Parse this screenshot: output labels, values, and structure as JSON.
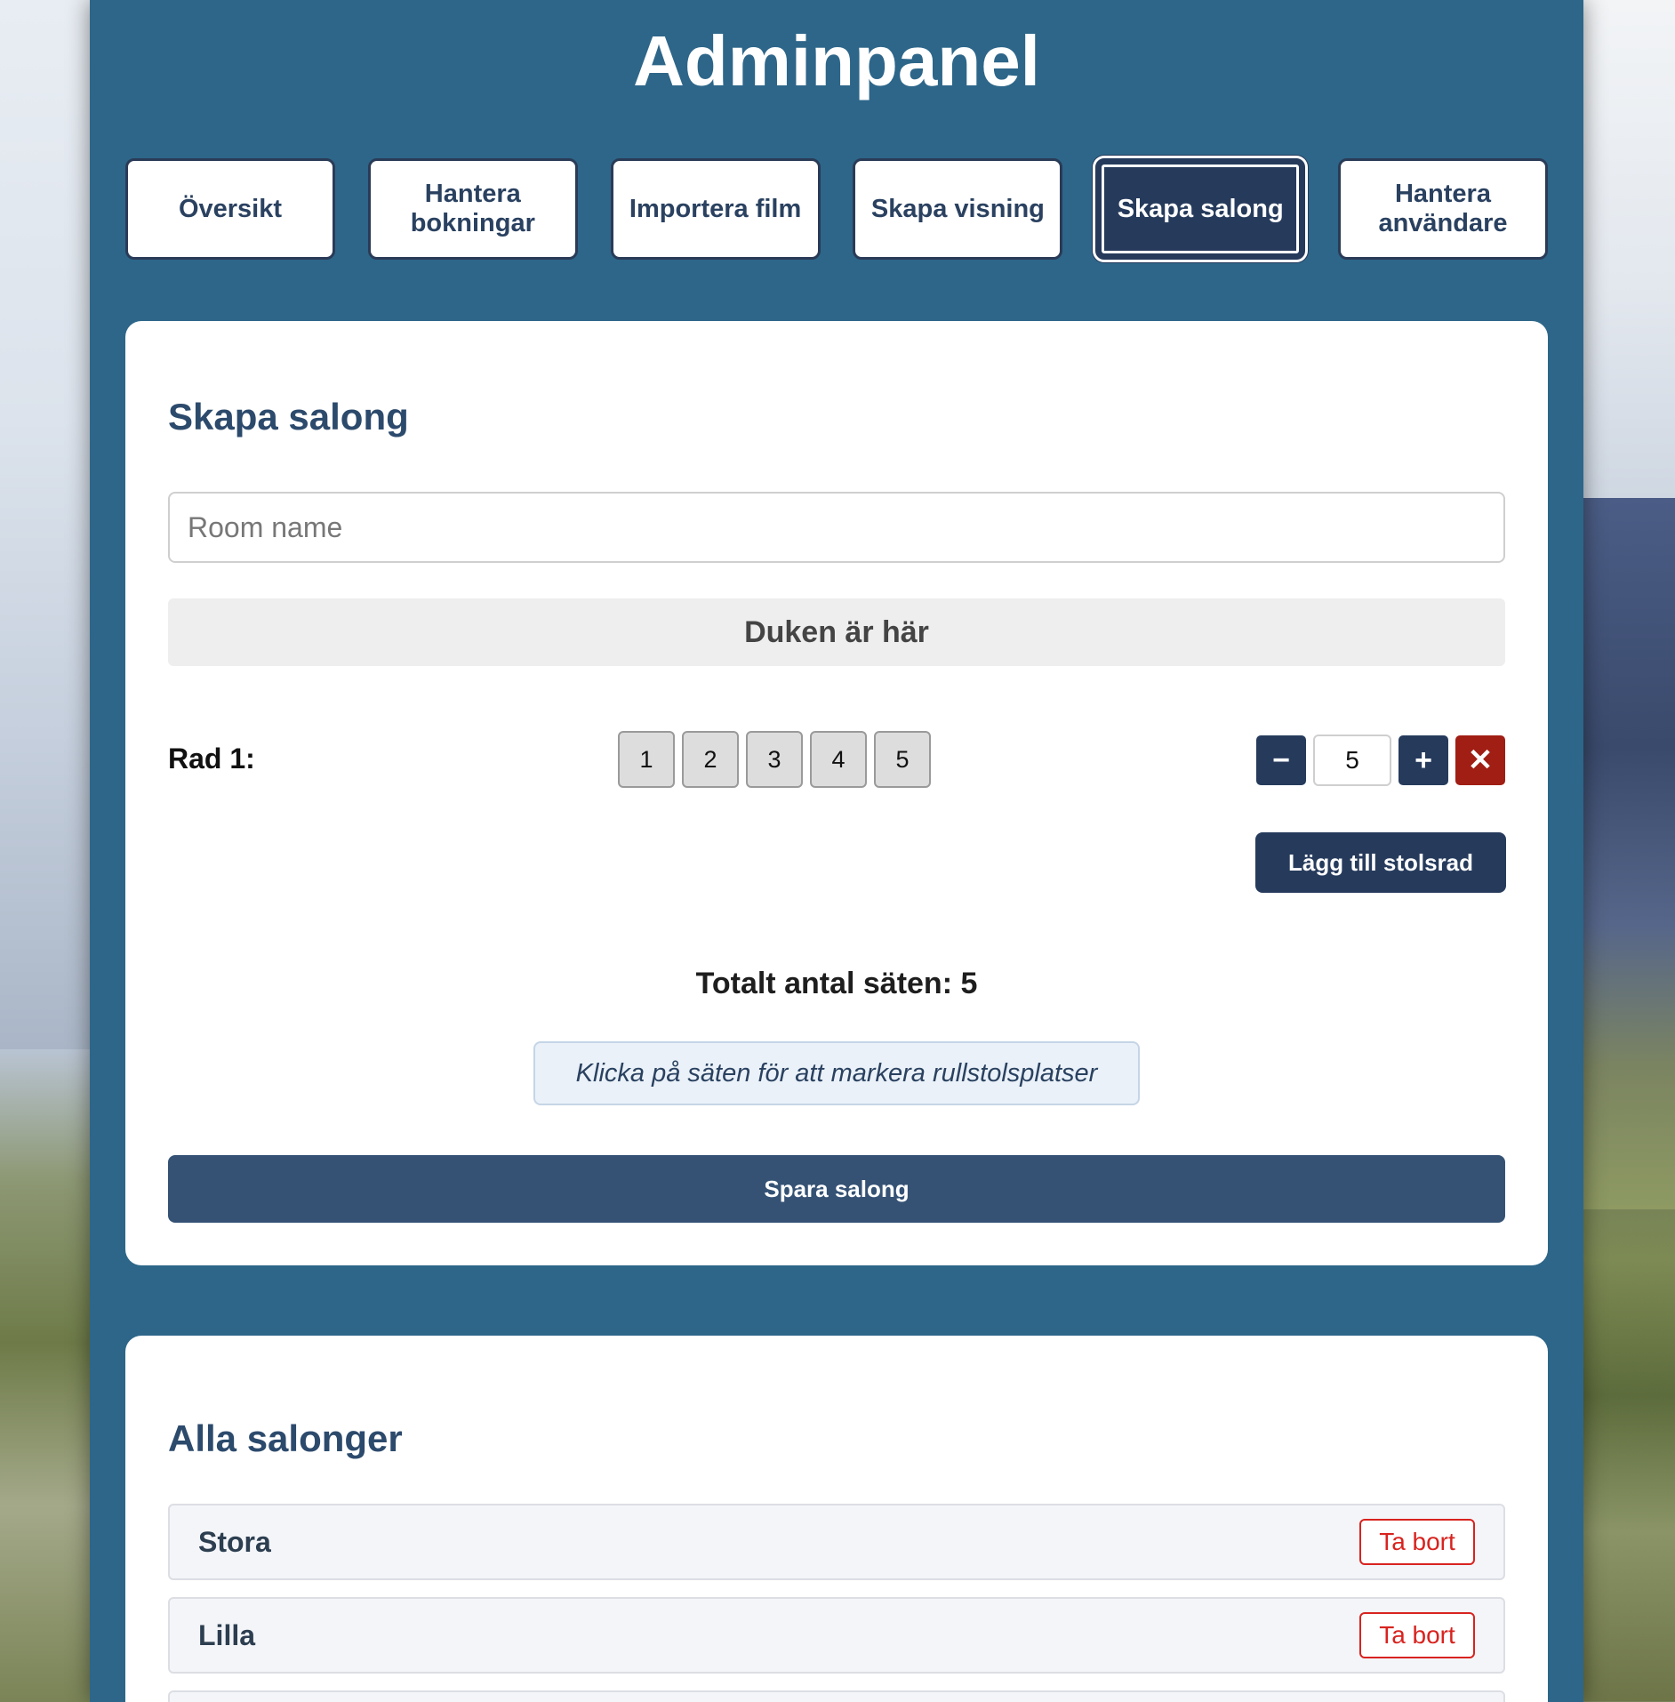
{
  "header": {
    "title": "Adminpanel"
  },
  "nav": {
    "items": [
      {
        "label": "Översikt"
      },
      {
        "label": "Hantera bokningar"
      },
      {
        "label": "Importera film"
      },
      {
        "label": "Skapa visning"
      },
      {
        "label": "Skapa salong",
        "active": true
      },
      {
        "label": "Hantera användare"
      }
    ]
  },
  "create_room": {
    "heading": "Skapa salong",
    "room_name_placeholder": "Room name",
    "room_name_value": "",
    "screen_label": "Duken är här",
    "rows": [
      {
        "label": "Rad 1:",
        "seats": [
          "1",
          "2",
          "3",
          "4",
          "5"
        ],
        "seat_count": "5",
        "minus_label": "−",
        "plus_label": "+",
        "remove_label": "✕"
      }
    ],
    "add_row_label": "Lägg till stolsrad",
    "total_label": "Totalt antal säten: 5",
    "hint": "Klicka på säten för att markera rullstolsplatser",
    "save_label": "Spara salong"
  },
  "room_list": {
    "heading": "Alla salonger",
    "rooms": [
      {
        "name": "Stora",
        "delete_label": "Ta bort"
      },
      {
        "name": "Lilla",
        "delete_label": "Ta bort"
      }
    ]
  },
  "colors": {
    "panel_bg": "#2d6689",
    "primary": "#263b5c",
    "heading": "#2c4a6c",
    "danger": "#d8231f",
    "remove_bg": "#a01e14"
  }
}
